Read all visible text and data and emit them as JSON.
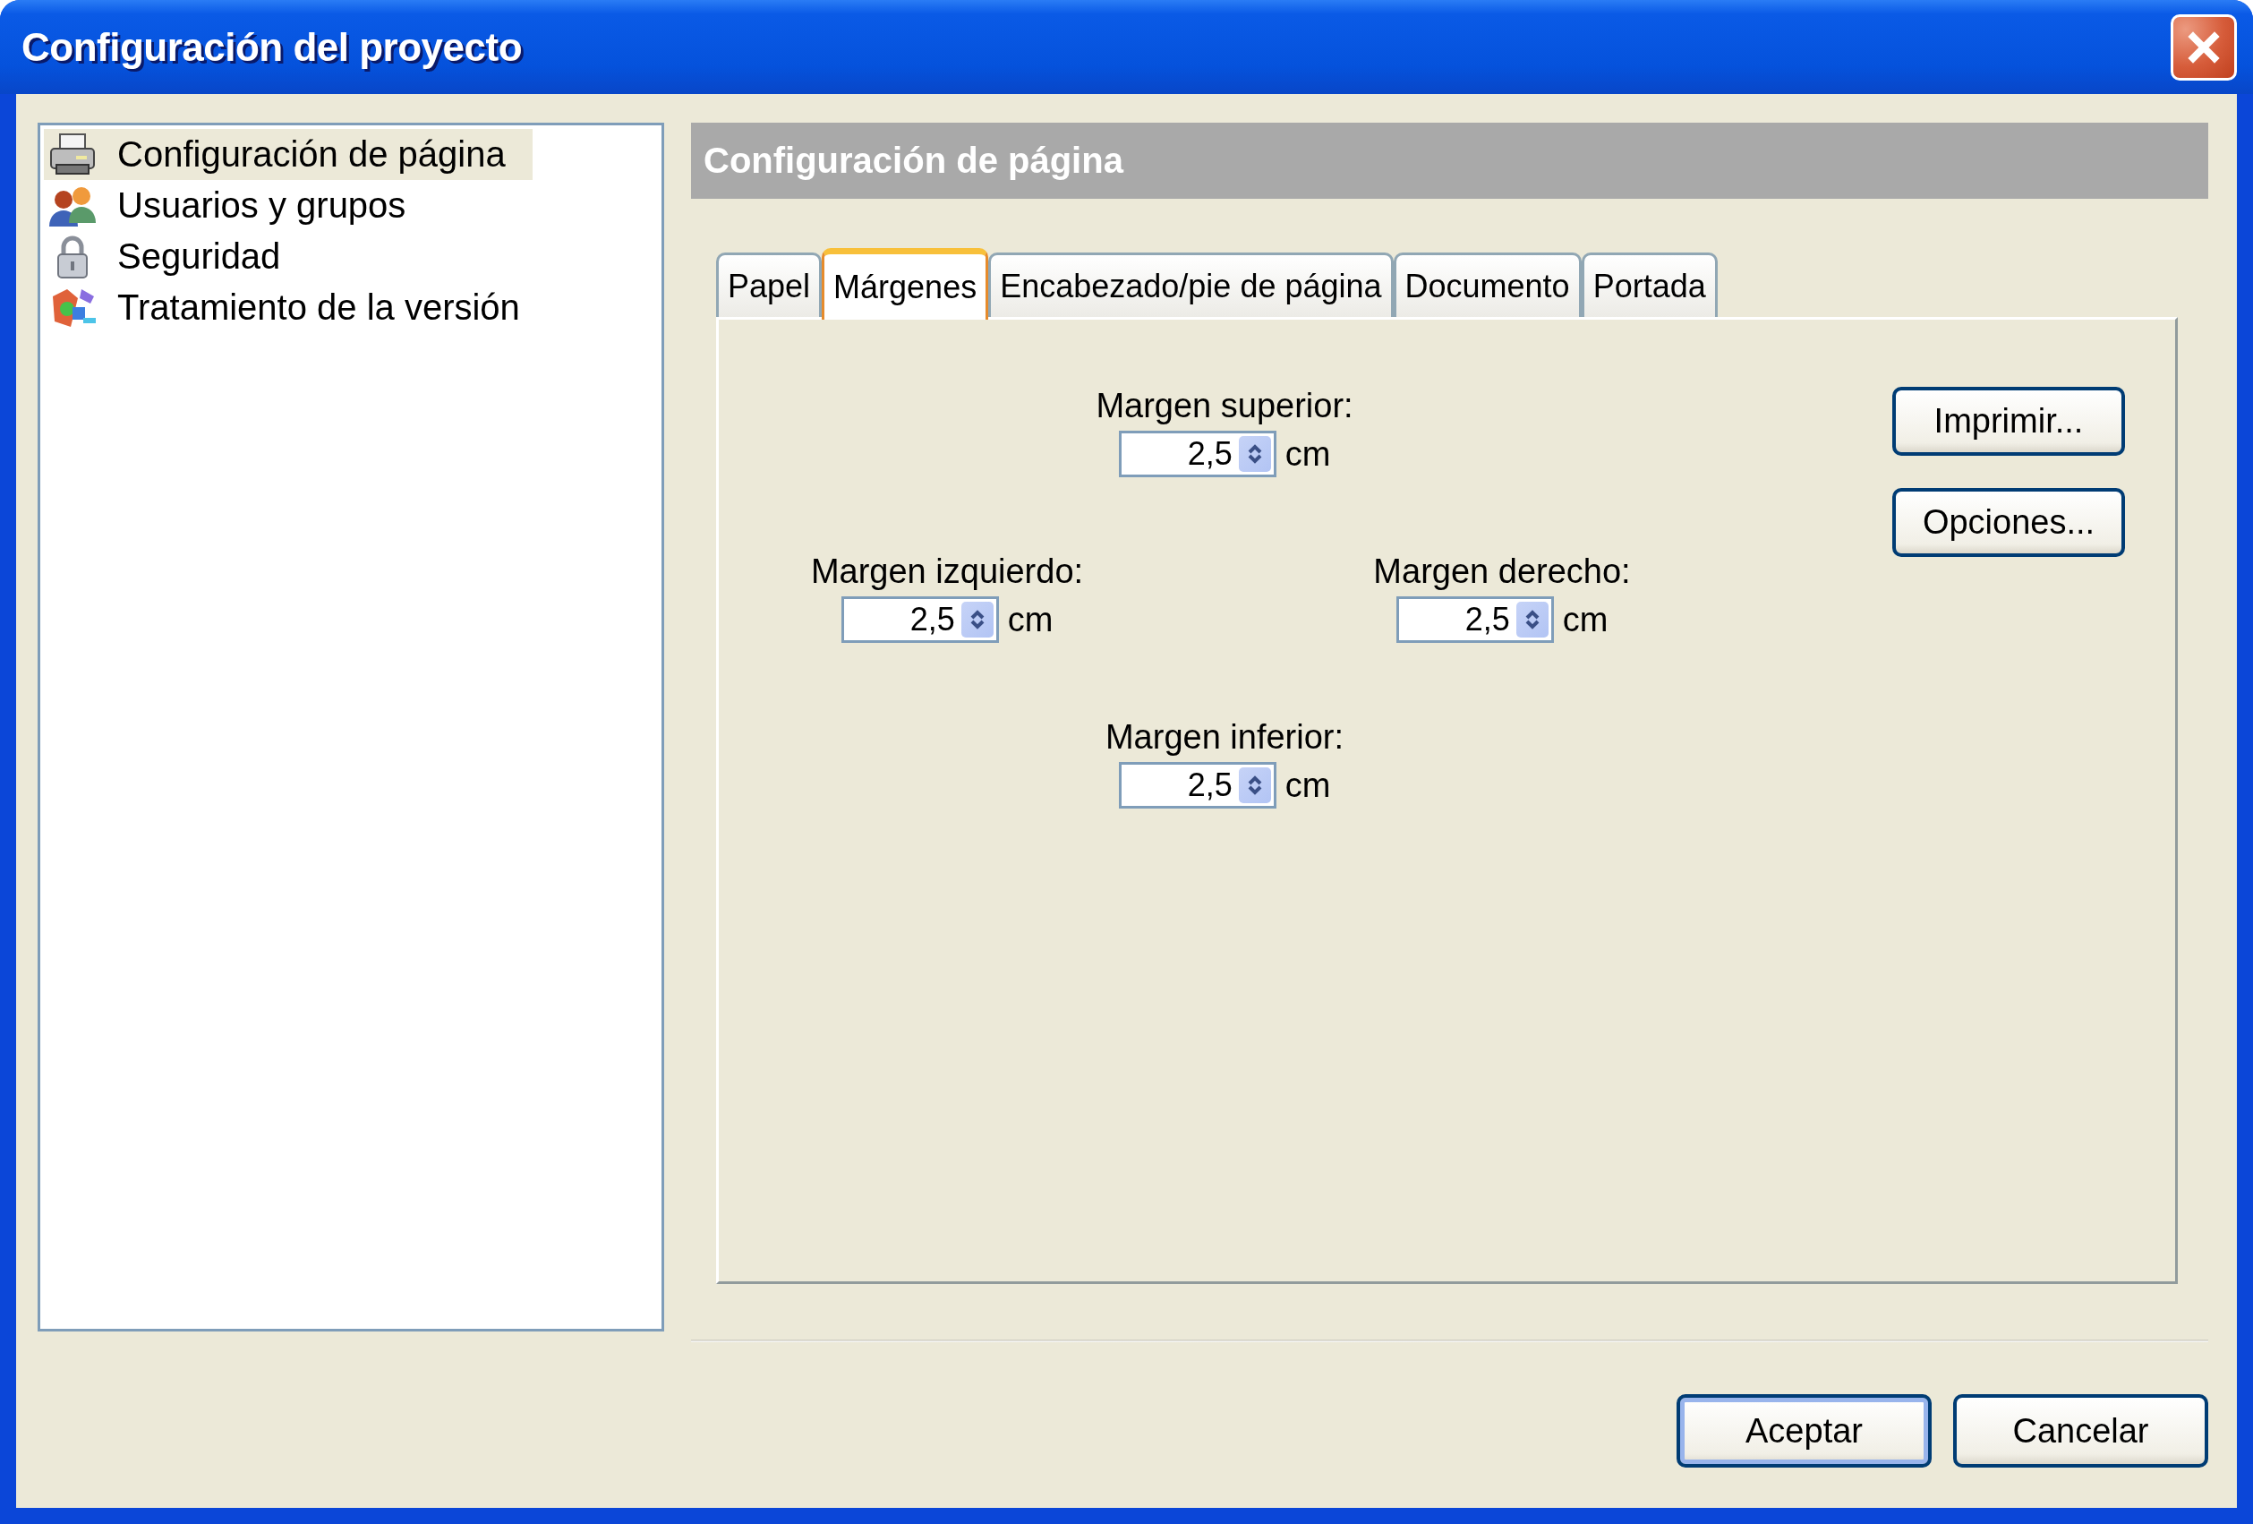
{
  "window": {
    "title": "Configuración del proyecto"
  },
  "sidebar": {
    "items": [
      {
        "label": "Configuración de página",
        "selected": true
      },
      {
        "label": "Usuarios y grupos",
        "selected": false
      },
      {
        "label": "Seguridad",
        "selected": false
      },
      {
        "label": "Tratamiento de la versión",
        "selected": false
      }
    ]
  },
  "panel": {
    "header": "Configuración de página",
    "tabs": [
      {
        "label": "Papel",
        "selected": false
      },
      {
        "label": "Márgenes",
        "selected": true
      },
      {
        "label": "Encabezado/pie de página",
        "selected": false
      },
      {
        "label": "Documento",
        "selected": false
      },
      {
        "label": "Portada",
        "selected": false
      }
    ],
    "fields": [
      {
        "label": "Margen superior:",
        "value": "2,5",
        "unit": "cm"
      },
      {
        "label": "Margen izquierdo:",
        "value": "2,5",
        "unit": "cm"
      },
      {
        "label": "Margen derecho:",
        "value": "2,5",
        "unit": "cm"
      },
      {
        "label": "Margen inferior:",
        "value": "2,5",
        "unit": "cm"
      }
    ],
    "side_buttons": [
      "Imprimir...",
      "Opciones..."
    ]
  },
  "footer": {
    "buttons": [
      {
        "label": "Aceptar",
        "default": true
      },
      {
        "label": "Cancelar",
        "default": false
      }
    ]
  }
}
